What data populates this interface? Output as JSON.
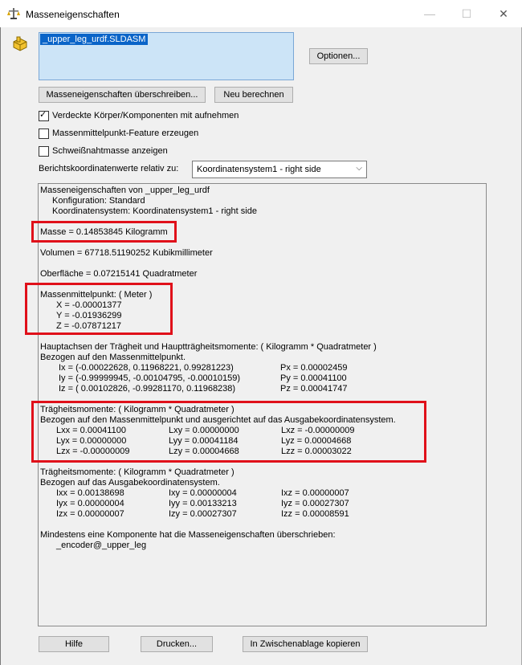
{
  "window": {
    "title": "Masseneigenschaften",
    "icon": "mass-properties-icon",
    "minimize_glyph": "—",
    "maximize_glyph": "☐",
    "close_glyph": "✕"
  },
  "files": [
    "_upper_leg_urdf.SLDASM"
  ],
  "buttons": {
    "options": "Optionen...",
    "override": "Masseneigenschaften überschreiben...",
    "recalculate": "Neu berechnen",
    "help": "Hilfe",
    "print": "Drucken...",
    "copy": "In Zwischenablage kopieren"
  },
  "checkboxes": [
    {
      "label": "Verdeckte Körper/Komponenten mit aufnehmen",
      "checked": true
    },
    {
      "label": "Massenmittelpunkt-Feature erzeugen",
      "checked": false
    },
    {
      "label": "Schweißnahtmasse anzeigen",
      "checked": false
    }
  ],
  "coord_system": {
    "label": "Berichtskoordinatenwerte relativ zu:",
    "selected": "Koordinatensystem1 - right side"
  },
  "report": {
    "header": [
      "Masseneigenschaften von _upper_leg_urdf",
      "Konfiguration: Standard",
      "Koordinatensystem: Koordinatensystem1 - right side"
    ],
    "mass": "Masse = 0.14853845 Kilogramm",
    "volume": "Volumen = 67718.51190252 Kubikmillimeter",
    "surface": "Oberfläche = 0.07215141 Quadratmeter",
    "com_title": "Massenmittelpunkt: ( Meter )",
    "com": [
      "X = -0.00001377",
      "Y = -0.01936299",
      "Z = -0.07871217"
    ],
    "principal_title": "Hauptachsen der Trägheit und Hauptträgheitsmomente: ( Kilogramm * Quadratmeter )",
    "principal_ref": "Bezogen auf den Massenmittelpunkt.",
    "principal_axes": [
      {
        "axis": "Ix = (-0.00022628,  0.11968221,  0.99281223)",
        "moment": "Px = 0.00002459"
      },
      {
        "axis": "Iy = (-0.99999945, -0.00104795, -0.00010159)",
        "moment": "Py = 0.00041100"
      },
      {
        "axis": "Iz = ( 0.00102826, -0.99281170,  0.11968238)",
        "moment": "Pz = 0.00041747"
      }
    ],
    "inertia_com_title": "Trägheitsmomente: ( Kilogramm * Quadratmeter )",
    "inertia_com_ref": "Bezogen auf den Massenmittelpunkt und ausgerichtet auf das Ausgabekoordinatensystem.",
    "inertia_com": [
      [
        "Lxx = 0.00041100",
        "Lxy = 0.00000000",
        "Lxz = -0.00000009"
      ],
      [
        "Lyx = 0.00000000",
        "Lyy = 0.00041184",
        "Lyz = 0.00004668"
      ],
      [
        "Lzx = -0.00000009",
        "Lzy = 0.00004668",
        "Lzz = 0.00003022"
      ]
    ],
    "inertia_out_title": "Trägheitsmomente: ( Kilogramm * Quadratmeter )",
    "inertia_out_ref": "Bezogen auf das Ausgabekoordinatensystem.",
    "inertia_out": [
      [
        "Ixx = 0.00138698",
        "Ixy = 0.00000004",
        "Ixz = 0.00000007"
      ],
      [
        "Iyx = 0.00000004",
        "Iyy = 0.00133213",
        "Iyz = 0.00027307"
      ],
      [
        "Izx = 0.00000007",
        "Izy = 0.00027307",
        "Izz = 0.00008591"
      ]
    ],
    "override_note": "Mindestens eine Komponente hat die Masseneigenschaften überschrieben:",
    "override_component": "_encoder@_upper_leg"
  },
  "colors": {
    "highlight": "#e0101a",
    "selection": "#0a64c8",
    "list_bg": "#cce4f7"
  }
}
